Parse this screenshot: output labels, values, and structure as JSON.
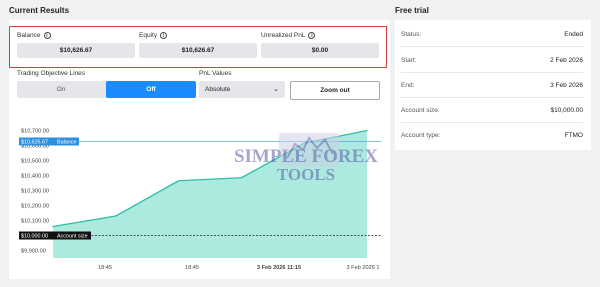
{
  "current_results": {
    "title": "Current Results"
  },
  "metrics": [
    {
      "label": "Balance",
      "value": "$10,626.67"
    },
    {
      "label": "Equity",
      "value": "$10,626.67"
    },
    {
      "label": "Unrealized PnL",
      "value": "$0.00"
    }
  ],
  "controls": {
    "objective_label": "Trading Objective Lines",
    "toggle_on": "On",
    "toggle_off": "Off",
    "pnl_label": "PnL Values",
    "pnl_selected": "Absolute",
    "zoom_out": "Zoom out"
  },
  "free_trial": {
    "title": "Free trial",
    "rows": [
      {
        "label": "Status:",
        "value": "Ended"
      },
      {
        "label": "Start:",
        "value": "2 Feb 2026"
      },
      {
        "label": "End:",
        "value": "3 Feb 2026"
      },
      {
        "label": "Account size:",
        "value": "$10,000.00"
      },
      {
        "label": "Account type:",
        "value": "FTMO"
      }
    ]
  },
  "watermark": {
    "line1": "SIMPLE FOREX",
    "line2": "TOOLS"
  },
  "colors": {
    "accent": "#1a8cff",
    "area": "#9ee5d9",
    "line": "#2bbfaa",
    "highlight_border": "#d93a3a"
  },
  "chart_data": {
    "type": "area",
    "y_ticks": [
      "$10,700.00",
      "$10,600.00",
      "$10,500.00",
      "$10,400.00",
      "$10,300.00",
      "$10,200.00",
      "$10,100.00",
      "$9,900.00"
    ],
    "x_ticks": [
      "18:45",
      "18:45",
      "3 Feb 2026 11:15",
      "3 Feb 2026 1"
    ],
    "ylim": [
      9850,
      10730
    ],
    "series": [
      {
        "values": [
          10060,
          10130,
          10365,
          10385,
          10615,
          10700
        ]
      }
    ],
    "reference_lines": [
      {
        "name": "Balance",
        "value": 10626.67,
        "label": "$10,626.67"
      },
      {
        "name": "Account size",
        "value": 10000,
        "label": "$10,000.00"
      }
    ]
  }
}
